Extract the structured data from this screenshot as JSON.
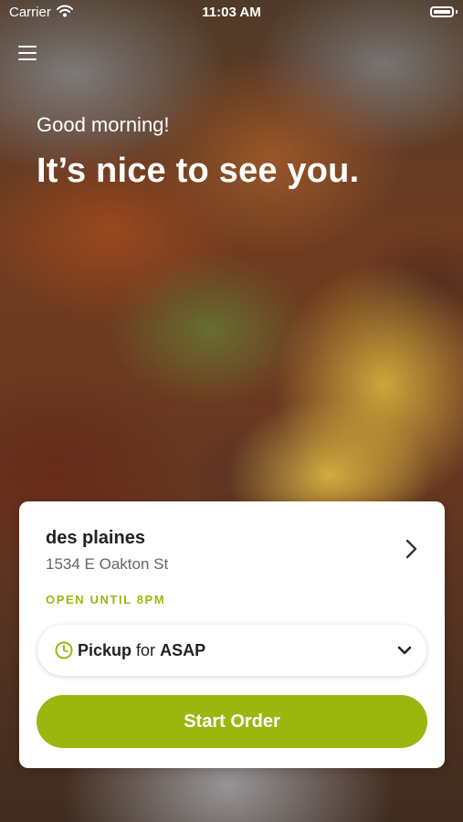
{
  "status_bar": {
    "carrier": "Carrier",
    "time": "11:03 AM"
  },
  "hero": {
    "greeting": "Good morning!",
    "headline": "It’s nice to see you."
  },
  "store": {
    "name": "des plaines",
    "address": "1534 E Oakton St",
    "hours": "OPEN UNTIL 8PM"
  },
  "order": {
    "mode": "Pickup",
    "for_text": "for",
    "time": "ASAP",
    "start_label": "Start Order"
  },
  "colors": {
    "accent": "#9bb70f"
  },
  "icons": {
    "wifi": "wifi-icon",
    "battery": "battery-icon",
    "menu": "hamburger-menu-icon",
    "chevron_right": "chevron-right-icon",
    "clock": "clock-icon",
    "chevron_down": "chevron-down-icon"
  }
}
